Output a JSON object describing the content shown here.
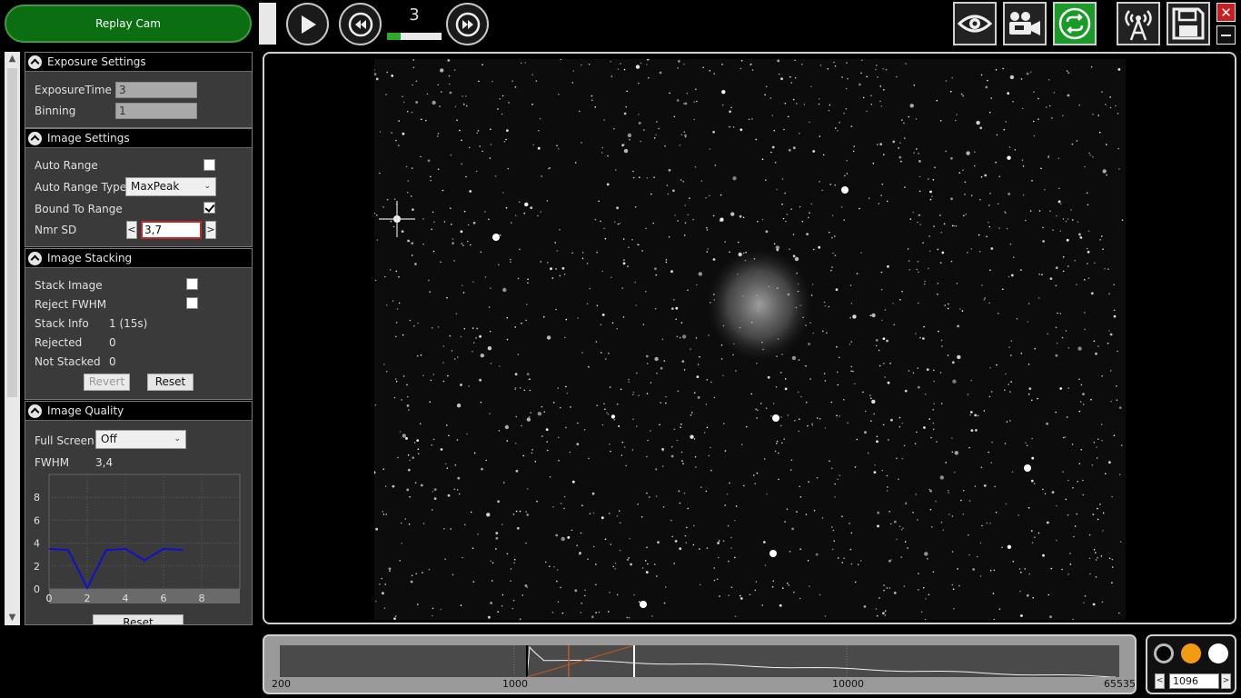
{
  "top": {
    "replay_label": "Replay Cam",
    "frame_number": "3",
    "frame_progress": 0.25
  },
  "exposure": {
    "title": "Exposure Settings",
    "exposure_time_label": "ExposureTime",
    "exposure_time_value": "3",
    "binning_label": "Binning",
    "binning_value": "1"
  },
  "image_settings": {
    "title": "Image Settings",
    "auto_range_label": "Auto Range",
    "auto_range_checked": false,
    "auto_range_type_label": "Auto Range Type",
    "auto_range_type_value": "MaxPeak",
    "bound_to_range_label": "Bound To Range",
    "bound_to_range_checked": true,
    "nmr_sd_label": "Nmr SD",
    "nmr_sd_value": "3,7",
    "dec": "<",
    "inc": ">"
  },
  "stacking": {
    "title": "Image Stacking",
    "stack_image_label": "Stack Image",
    "reject_fwhm_label": "Reject FWHM",
    "stack_info_label": "Stack Info",
    "stack_info_value": "1 (15s)",
    "rejected_label": "Rejected",
    "rejected_value": "0",
    "not_stacked_label": "Not Stacked",
    "not_stacked_value": "0",
    "revert_label": "Revert",
    "reset_label": "Reset"
  },
  "quality": {
    "title": "Image Quality",
    "full_screen_label": "Full Screen",
    "full_screen_value": "Off",
    "fwhm_label": "FWHM",
    "fwhm_value": "3,4",
    "reset_label": "Reset"
  },
  "chart_data": {
    "type": "line",
    "title": "",
    "xlabel": "",
    "ylabel": "",
    "xlim": [
      0,
      10
    ],
    "ylim": [
      0,
      10
    ],
    "x_ticks": [
      "0",
      "2",
      "4",
      "6",
      "8"
    ],
    "y_ticks": [
      "0",
      "2",
      "4",
      "6",
      "8"
    ],
    "grid": true,
    "series": [
      {
        "x": [
          0,
          1,
          2,
          3,
          4,
          5,
          6,
          7
        ],
        "values": [
          3.5,
          3.4,
          0.1,
          3.4,
          3.5,
          2.5,
          3.5,
          3.4
        ],
        "color": "#1010d0"
      }
    ]
  },
  "histogram": {
    "tick_labels": [
      "200",
      "1000",
      "10000",
      "65535"
    ],
    "black_point": "1000",
    "white_point": "2500"
  },
  "color_picker": {
    "value": "1096",
    "dec": "<",
    "inc": ">",
    "colors": [
      "#000000",
      "#f39c12",
      "#ffffff"
    ]
  },
  "icons": [
    "play-icon",
    "rewind-icon",
    "fast-forward-icon",
    "eye-icon",
    "camera-icon",
    "loop-icon",
    "broadcast-icon",
    "save-icon",
    "close-icon",
    "minimize-icon"
  ],
  "colors": {
    "accent_green": "#0b6e12",
    "active_tool": "#1a9a26",
    "close_red": "#c81e1e",
    "nmr_border": "#c0282c"
  }
}
